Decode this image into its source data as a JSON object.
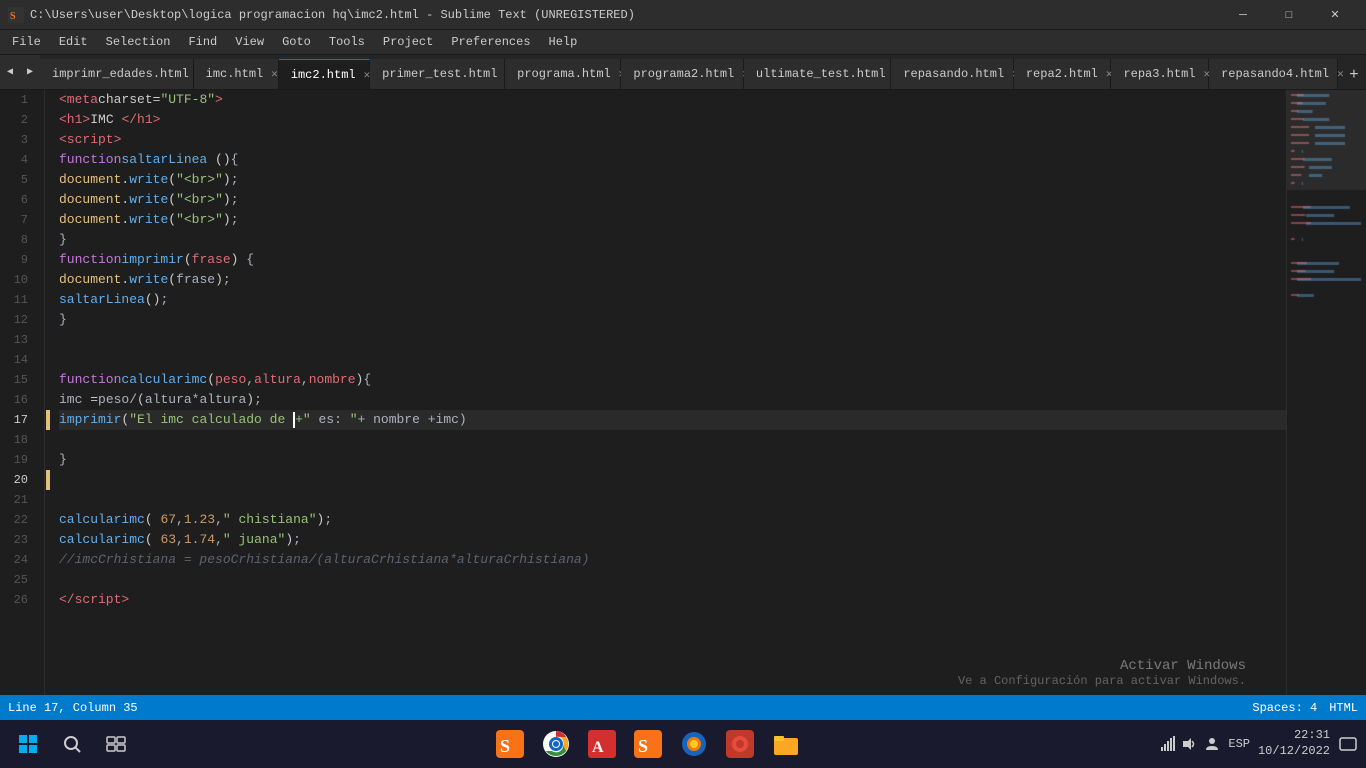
{
  "titlebar": {
    "title": "C:\\Users\\user\\Desktop\\logica programacion hq\\imc2.html - Sublime Text (UNREGISTERED)",
    "icon": "ST"
  },
  "window_controls": {
    "minimize": "─",
    "maximize": "□",
    "close": "✕"
  },
  "menu": {
    "items": [
      "File",
      "Edit",
      "Selection",
      "Find",
      "View",
      "Goto",
      "Tools",
      "Project",
      "Preferences",
      "Help"
    ]
  },
  "tabs": [
    {
      "label": "imprimr_edades.html",
      "active": false
    },
    {
      "label": "imc.html",
      "active": false
    },
    {
      "label": "imc2.html",
      "active": true
    },
    {
      "label": "primer_test.html",
      "active": false
    },
    {
      "label": "programa.html",
      "active": false
    },
    {
      "label": "programa2.html",
      "active": false
    },
    {
      "label": "ultimate_test.html",
      "active": false
    },
    {
      "label": "repasando.html",
      "active": false
    },
    {
      "label": "repa2.html",
      "active": false
    },
    {
      "label": "repa3.html",
      "active": false
    },
    {
      "label": "repasando4.html",
      "active": false
    }
  ],
  "status": {
    "line_col": "Line 17, Column 35",
    "spaces": "Spaces: 4",
    "lang": "HTML"
  },
  "taskbar": {
    "start_label": "⊞",
    "search_label": "🔍",
    "taskview_label": "❑",
    "clock_time": "22:31",
    "clock_date": "10/12/2022",
    "language": "ESP"
  },
  "win_activate": {
    "title": "Activar Windows",
    "subtitle": "Ve a Configuración para activar Windows."
  },
  "code_lines": [
    {
      "num": 1,
      "indicator": false,
      "content_html": "    <span class='tag'>&lt;meta</span> <span class='attr'>charset</span>=<span class='str'>\"UTF-8\"</span><span class='tag'>&gt;</span>"
    },
    {
      "num": 2,
      "indicator": false,
      "content_html": "    <span class='tag'>&lt;h1&gt;</span>IMC <span class='tag'>&lt;/h1&gt;</span>"
    },
    {
      "num": 3,
      "indicator": false,
      "content_html": "    <span class='tag'>&lt;script&gt;</span>"
    },
    {
      "num": 4,
      "indicator": false,
      "content_html": "        <span class='kw'>function</span> <span class='fn'>saltarLinea</span> ()<span class='punct'>{</span>"
    },
    {
      "num": 5,
      "indicator": false,
      "content_html": "                <span class='obj'>document</span>.<span class='method'>write</span>(<span class='str'>\"&lt;br&gt;\"</span>)<span class='punct'>;</span>"
    },
    {
      "num": 6,
      "indicator": false,
      "content_html": "                <span class='obj'>document</span>.<span class='method'>write</span>(<span class='str'>\"&lt;br&gt;\"</span>)<span class='punct'>;</span>"
    },
    {
      "num": 7,
      "indicator": false,
      "content_html": "                <span class='obj'>document</span>.<span class='method'>write</span>(<span class='str'>\"&lt;br&gt;\"</span>)<span class='punct'>;</span>"
    },
    {
      "num": 8,
      "indicator": false,
      "content_html": "        <span class='punct'>}</span>"
    },
    {
      "num": 9,
      "indicator": false,
      "content_html": "        <span class='kw'>function</span> <span class='fn'>imprimir</span>(<span class='param'>frase</span>) <span class='punct'>{</span>"
    },
    {
      "num": 10,
      "indicator": false,
      "content_html": "            <span class='obj'>document</span>.<span class='method'>write</span>(<span class='plain'>frase</span>)<span class='punct'>;</span>"
    },
    {
      "num": 11,
      "indicator": false,
      "content_html": "            <span class='fn'>saltarLinea</span>()<span class='punct'>;</span>"
    },
    {
      "num": 12,
      "indicator": false,
      "content_html": "        <span class='punct'>}</span>"
    },
    {
      "num": 13,
      "indicator": false,
      "content_html": ""
    },
    {
      "num": 14,
      "indicator": false,
      "content_html": ""
    },
    {
      "num": 15,
      "indicator": false,
      "content_html": "        <span class='kw'>function</span> <span class='fn'>calcularimc</span>(<span class='param'>peso</span><span class='punct'>,</span><span class='param'>altura</span><span class='punct'>,</span><span class='param'>nombre</span>)<span class='punct'>{</span>"
    },
    {
      "num": 16,
      "indicator": false,
      "content_html": "          <span class='plain'>imc</span> =<span class='plain'>peso</span><span class='punct'>/</span>(<span class='plain'>altura</span><span class='punct'>*</span><span class='plain'>altura</span>)<span class='punct'>;</span>"
    },
    {
      "num": 17,
      "indicator": true,
      "content_html": "          <span class='fn'>imprimir</span>(<span class='str'>\"El imc calculado de </span>|<span class='str'>+\" es: \"</span>+ nombre +imc<span class='punct'>)</span>",
      "cursor_pos": true
    },
    {
      "num": 18,
      "indicator": false,
      "content_html": ""
    },
    {
      "num": 19,
      "indicator": false,
      "content_html": "        <span class='punct'>}</span>"
    },
    {
      "num": 20,
      "indicator": true,
      "content_html": ""
    },
    {
      "num": 21,
      "indicator": false,
      "content_html": ""
    },
    {
      "num": 22,
      "indicator": false,
      "content_html": "    <span class='fn'>calcularimc</span>( <span class='num'>67</span><span class='punct'>,</span><span class='num'>1.23</span> <span class='punct'>,</span><span class='str'>\" chistiana\"</span>)<span class='punct'>;</span>"
    },
    {
      "num": 23,
      "indicator": false,
      "content_html": "    <span class='fn'>calcularimc</span>( <span class='num'>63</span><span class='punct'>,</span><span class='num'>1.74</span><span class='punct'>,</span> <span class='str'>\" juana\"</span>)<span class='punct'>;</span>"
    },
    {
      "num": 24,
      "indicator": false,
      "content_html": "    <span class='comment'>//imcCrhistiana = pesoCrhistiana/(alturaCrhistiana*alturaCrhistiana)</span>"
    },
    {
      "num": 25,
      "indicator": false,
      "content_html": ""
    },
    {
      "num": 26,
      "indicator": false,
      "content_html": "    <span class='tag'>&lt;/script&gt;</span>"
    }
  ]
}
